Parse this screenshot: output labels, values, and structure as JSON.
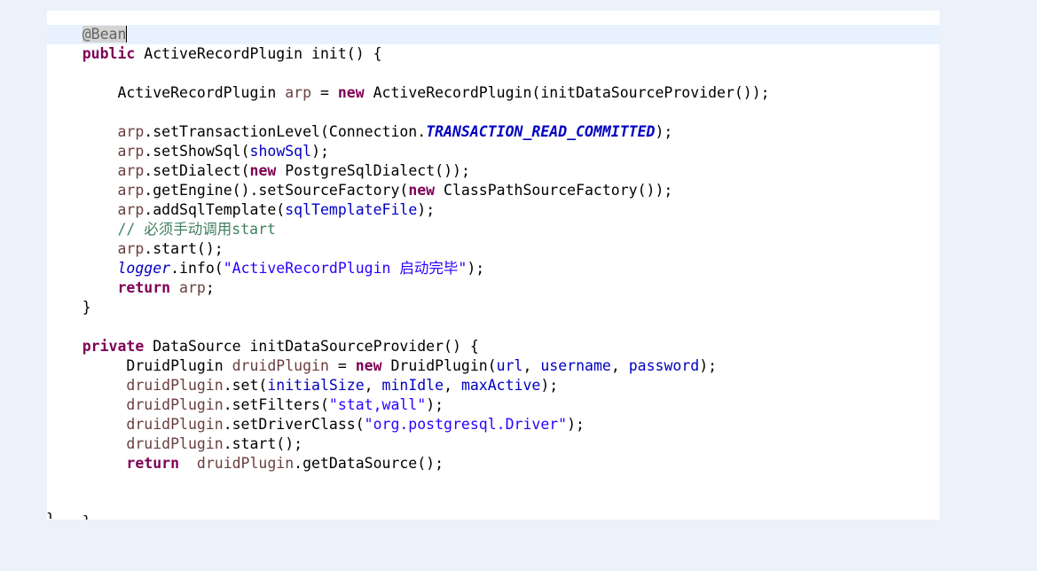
{
  "code_lines": [
    [
      [
        "    ",
        "d"
      ],
      [
        "@Bean",
        "ah"
      ],
      [
        "|caret",
        "caret"
      ]
    ],
    [
      [
        "    ",
        "d"
      ],
      [
        "public",
        "k"
      ],
      [
        " ActiveRecordPlugin init() {",
        "d"
      ]
    ],
    [],
    [
      [
        "        ActiveRecordPlugin ",
        "d"
      ],
      [
        "arp",
        "v"
      ],
      [
        " = ",
        "d"
      ],
      [
        "new",
        "k"
      ],
      [
        " ActiveRecordPlugin(initDataSourceProvider());",
        "d"
      ]
    ],
    [],
    [
      [
        "        ",
        "d"
      ],
      [
        "arp",
        "v"
      ],
      [
        ".setTransactionLevel(Connection.",
        "d"
      ],
      [
        "TRANSACTION_READ_COMMITTED",
        "fbi"
      ],
      [
        ");",
        "d"
      ]
    ],
    [
      [
        "        ",
        "d"
      ],
      [
        "arp",
        "v"
      ],
      [
        ".setShowSql(",
        "d"
      ],
      [
        "showSql",
        "f"
      ],
      [
        ");",
        "d"
      ]
    ],
    [
      [
        "        ",
        "d"
      ],
      [
        "arp",
        "v"
      ],
      [
        ".setDialect(",
        "d"
      ],
      [
        "new",
        "k"
      ],
      [
        " PostgreSqlDialect());",
        "d"
      ]
    ],
    [
      [
        "        ",
        "d"
      ],
      [
        "arp",
        "v"
      ],
      [
        ".getEngine().setSourceFactory(",
        "d"
      ],
      [
        "new",
        "k"
      ],
      [
        " ClassPathSourceFactory());",
        "d"
      ]
    ],
    [
      [
        "        ",
        "d"
      ],
      [
        "arp",
        "v"
      ],
      [
        ".addSqlTemplate(",
        "d"
      ],
      [
        "sqlTemplateFile",
        "f"
      ],
      [
        ");",
        "d"
      ]
    ],
    [
      [
        "        ",
        "d"
      ],
      [
        "// 必须手动调用start",
        "c"
      ]
    ],
    [
      [
        "        ",
        "d"
      ],
      [
        "arp",
        "v"
      ],
      [
        ".start();",
        "d"
      ]
    ],
    [
      [
        "        ",
        "d"
      ],
      [
        "logger",
        "fi"
      ],
      [
        ".info(",
        "d"
      ],
      [
        "\"ActiveRecordPlugin 启动完毕\"",
        "s"
      ],
      [
        ");",
        "d"
      ]
    ],
    [
      [
        "        ",
        "d"
      ],
      [
        "return",
        "k"
      ],
      [
        " ",
        "d"
      ],
      [
        "arp",
        "v"
      ],
      [
        ";",
        "d"
      ]
    ],
    [
      [
        "    }",
        "d"
      ]
    ],
    [],
    [
      [
        "    ",
        "d"
      ],
      [
        "private",
        "k"
      ],
      [
        " DataSource initDataSourceProvider() {",
        "d"
      ]
    ],
    [
      [
        "         DruidPlugin ",
        "d"
      ],
      [
        "druidPlugin",
        "v"
      ],
      [
        " = ",
        "d"
      ],
      [
        "new",
        "k"
      ],
      [
        " DruidPlugin(",
        "d"
      ],
      [
        "url",
        "f"
      ],
      [
        ", ",
        "d"
      ],
      [
        "username",
        "f"
      ],
      [
        ", ",
        "d"
      ],
      [
        "password",
        "f"
      ],
      [
        ");",
        "d"
      ]
    ],
    [
      [
        "         ",
        "d"
      ],
      [
        "druidPlugin",
        "v"
      ],
      [
        ".set(",
        "d"
      ],
      [
        "initialSize",
        "f"
      ],
      [
        ", ",
        "d"
      ],
      [
        "minIdle",
        "f"
      ],
      [
        ", ",
        "d"
      ],
      [
        "maxActive",
        "f"
      ],
      [
        ");",
        "d"
      ]
    ],
    [
      [
        "         ",
        "d"
      ],
      [
        "druidPlugin",
        "v"
      ],
      [
        ".setFilters(",
        "d"
      ],
      [
        "\"stat,wall\"",
        "s"
      ],
      [
        ");",
        "d"
      ]
    ],
    [
      [
        "         ",
        "d"
      ],
      [
        "druidPlugin",
        "v"
      ],
      [
        ".setDriverClass(",
        "d"
      ],
      [
        "\"org.postgresql.Driver\"",
        "s"
      ],
      [
        ");",
        "d"
      ]
    ],
    [
      [
        "         ",
        "d"
      ],
      [
        "druidPlugin",
        "v"
      ],
      [
        ".start();",
        "d"
      ]
    ],
    [
      [
        "         ",
        "d"
      ],
      [
        "return",
        "k"
      ],
      [
        "  ",
        "d"
      ],
      [
        "druidPlugin",
        "v"
      ],
      [
        ".getDataSource();",
        "d"
      ]
    ],
    [],
    [],
    [
      [
        "    }",
        "d"
      ]
    ]
  ],
  "closing_brace": "}",
  "colors": {
    "background": "#edf1f9",
    "editor": "#ffffff",
    "current_line": "#e8f2fe",
    "keyword": "#7f0055",
    "field": "#0000c0",
    "string": "#2a00ff",
    "comment": "#3f7f5f",
    "local_variable": "#6a3e3e",
    "annotation": "#646464"
  }
}
